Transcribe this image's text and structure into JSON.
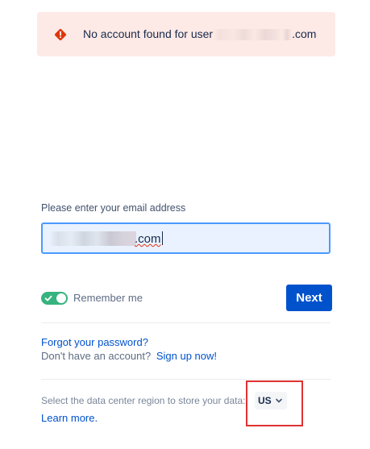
{
  "alert": {
    "icon": "error-diamond-icon",
    "text_prefix": "No account found for user",
    "text_suffix": ".com",
    "color": "#de350b"
  },
  "email": {
    "label": "Please enter your email address",
    "value_suffix": ".com"
  },
  "remember": {
    "label": "Remember me",
    "checked": true,
    "color": "#36b37e"
  },
  "next_button": {
    "label": "Next",
    "color": "#0052cc"
  },
  "links": {
    "forgot_password": "Forgot your password?",
    "no_account": "Don't have an account?",
    "sign_up": "Sign up now!",
    "learn_more": "Learn more."
  },
  "region": {
    "prompt": "Select the data center region to store your data:",
    "selected": "US",
    "icon": "chevron-down-icon"
  }
}
